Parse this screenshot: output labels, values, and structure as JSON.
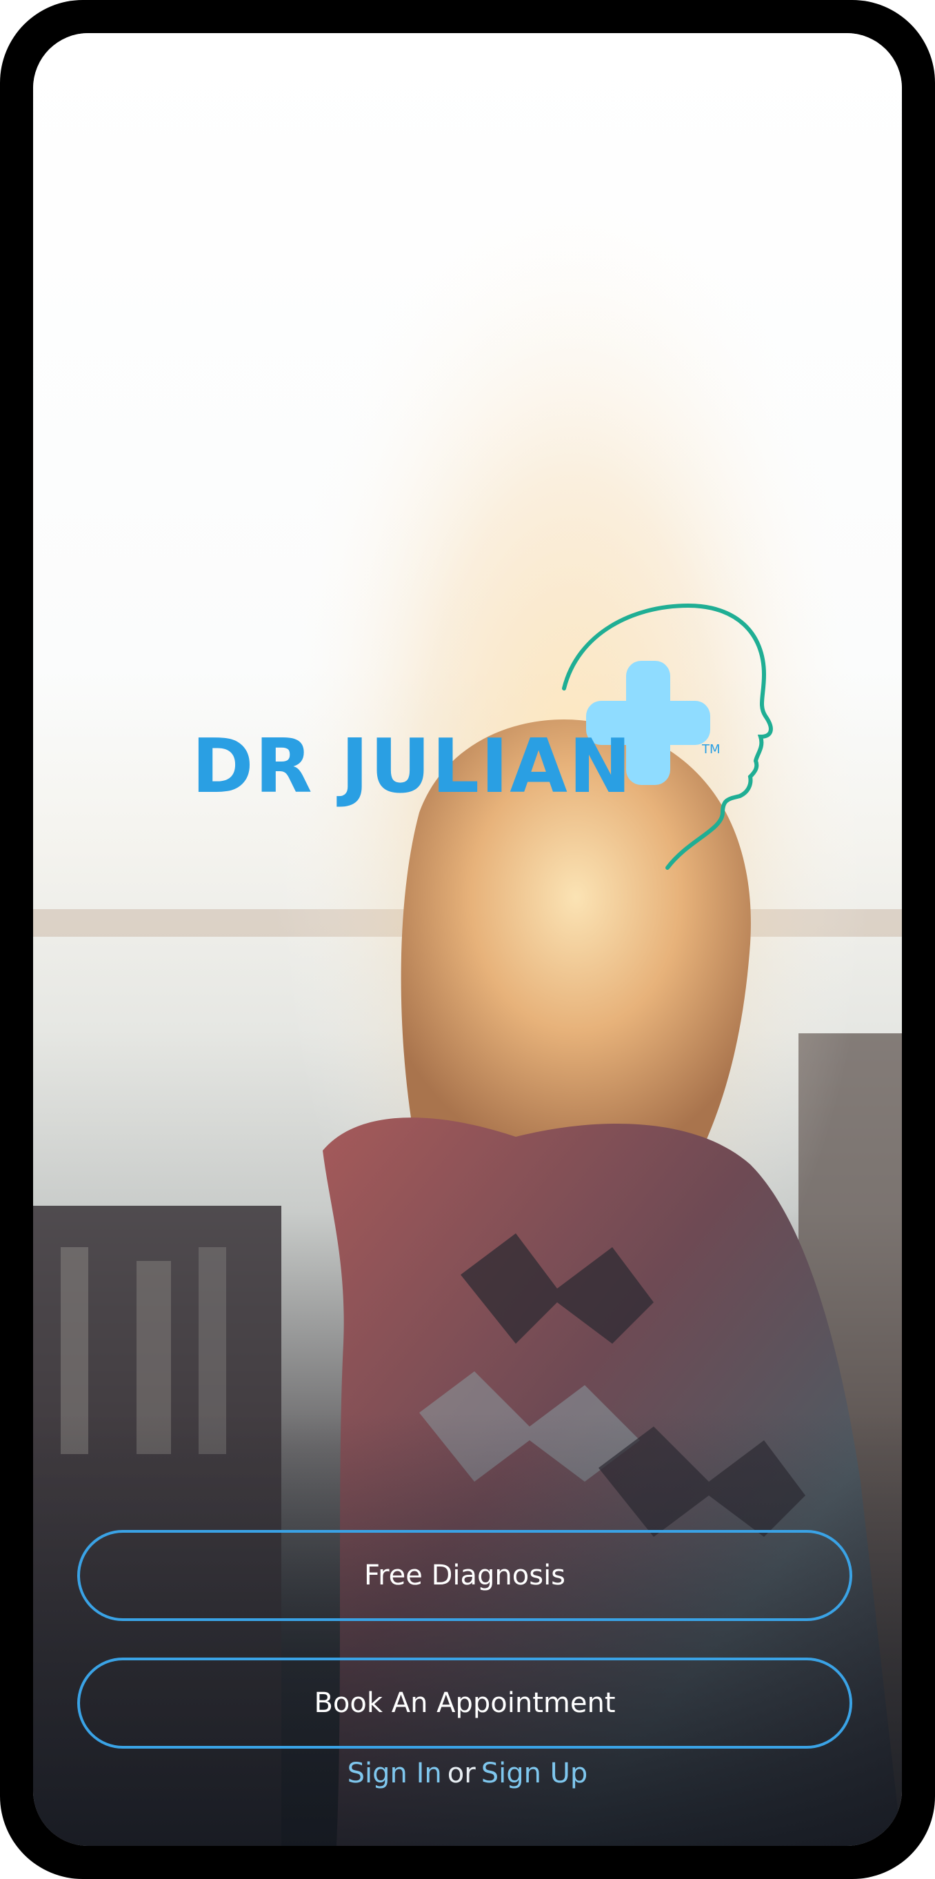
{
  "brand": {
    "name": "DR JULIAN",
    "trademark": "TM",
    "logo_icon": "head-with-plus-icon",
    "text_color": "#2a9fe3",
    "plus_color": "#8fdcff",
    "outline_color": "#1fae94"
  },
  "actions": {
    "free_diagnosis_label": "Free Diagnosis",
    "book_appointment_label": "Book An Appointment"
  },
  "auth": {
    "sign_in_label": "Sign In",
    "or_label": "or",
    "sign_up_label": "Sign Up"
  },
  "background": {
    "description_icon": "woman-lake-photo"
  }
}
